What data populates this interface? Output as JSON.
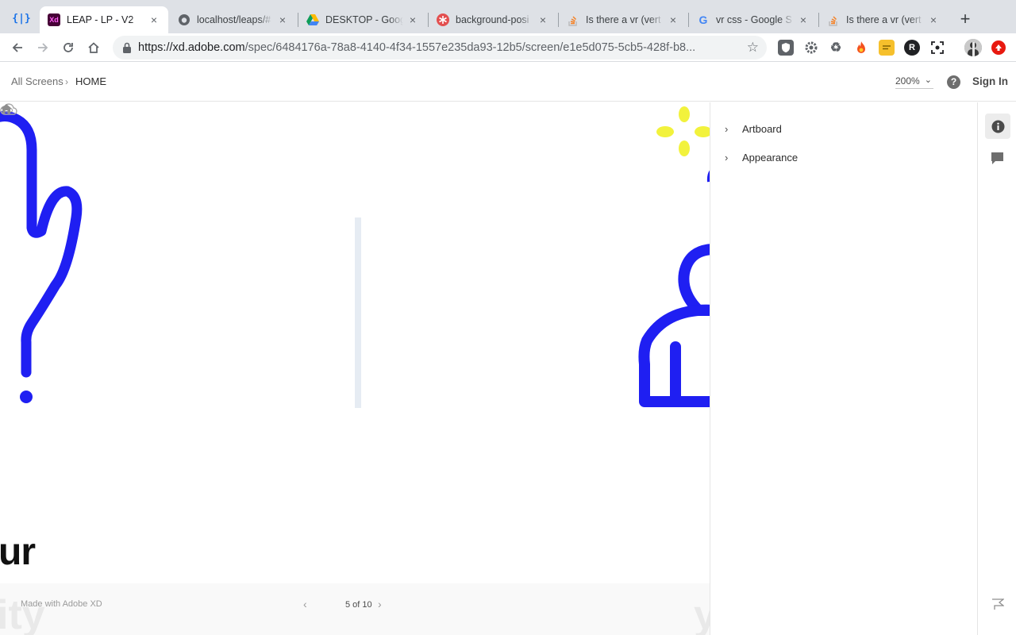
{
  "browser": {
    "apps_label": "{|}",
    "tabs": [
      {
        "title": "LEAP - LP - V2",
        "favicon": "Xd",
        "favicon_color": "#470137",
        "active": true
      },
      {
        "title": "localhost/leaps/#",
        "favicon": "",
        "favicon_color": "#5f6368",
        "active": false
      },
      {
        "title": "DESKTOP - Goog",
        "favicon": "",
        "favicon_color": "#1fa463",
        "active": false
      },
      {
        "title": "background-posi",
        "favicon": "",
        "favicon_color": "#e34f4f",
        "active": false
      },
      {
        "title": "Is there a vr (vert",
        "favicon": "",
        "favicon_color": "#f48024",
        "active": false
      },
      {
        "title": "vr css - Google S",
        "favicon": "G",
        "favicon_color": "#4285f4",
        "active": false
      },
      {
        "title": "Is there a vr (vert",
        "favicon": "",
        "favicon_color": "#f48024",
        "active": false
      }
    ],
    "tab_close_glyph": "×",
    "new_tab_glyph": "+",
    "url_host": "https://xd.adobe.com",
    "url_path": "/spec/6484176a-78a8-4140-4f34-1557e235da93-12b5/screen/e1e5d075-5cb5-428f-b8...",
    "bookmark_glyph": "☆"
  },
  "xd": {
    "breadcrumb_all": "All Screens",
    "breadcrumb_sep": "›",
    "breadcrumb_current": "HOME",
    "zoom": "200%",
    "zoom_chevron": "⌄",
    "help_glyph": "?",
    "sign_in": "Sign In"
  },
  "canvas": {
    "heading_fragment": "ur",
    "ghost_left": "ity",
    "ghost_right": "y",
    "accent_blue": "#1f1ff2",
    "accent_yellow": "#f2f23c",
    "divider_color": "#e6ecf3"
  },
  "footer": {
    "made_with": "Made with Adobe XD",
    "prev_glyph": "‹",
    "next_glyph": "›",
    "page_count": "5 of 10"
  },
  "inspect": {
    "sections": [
      {
        "label": "Artboard",
        "chevron": "›"
      },
      {
        "label": "Appearance",
        "chevron": "›"
      }
    ]
  }
}
